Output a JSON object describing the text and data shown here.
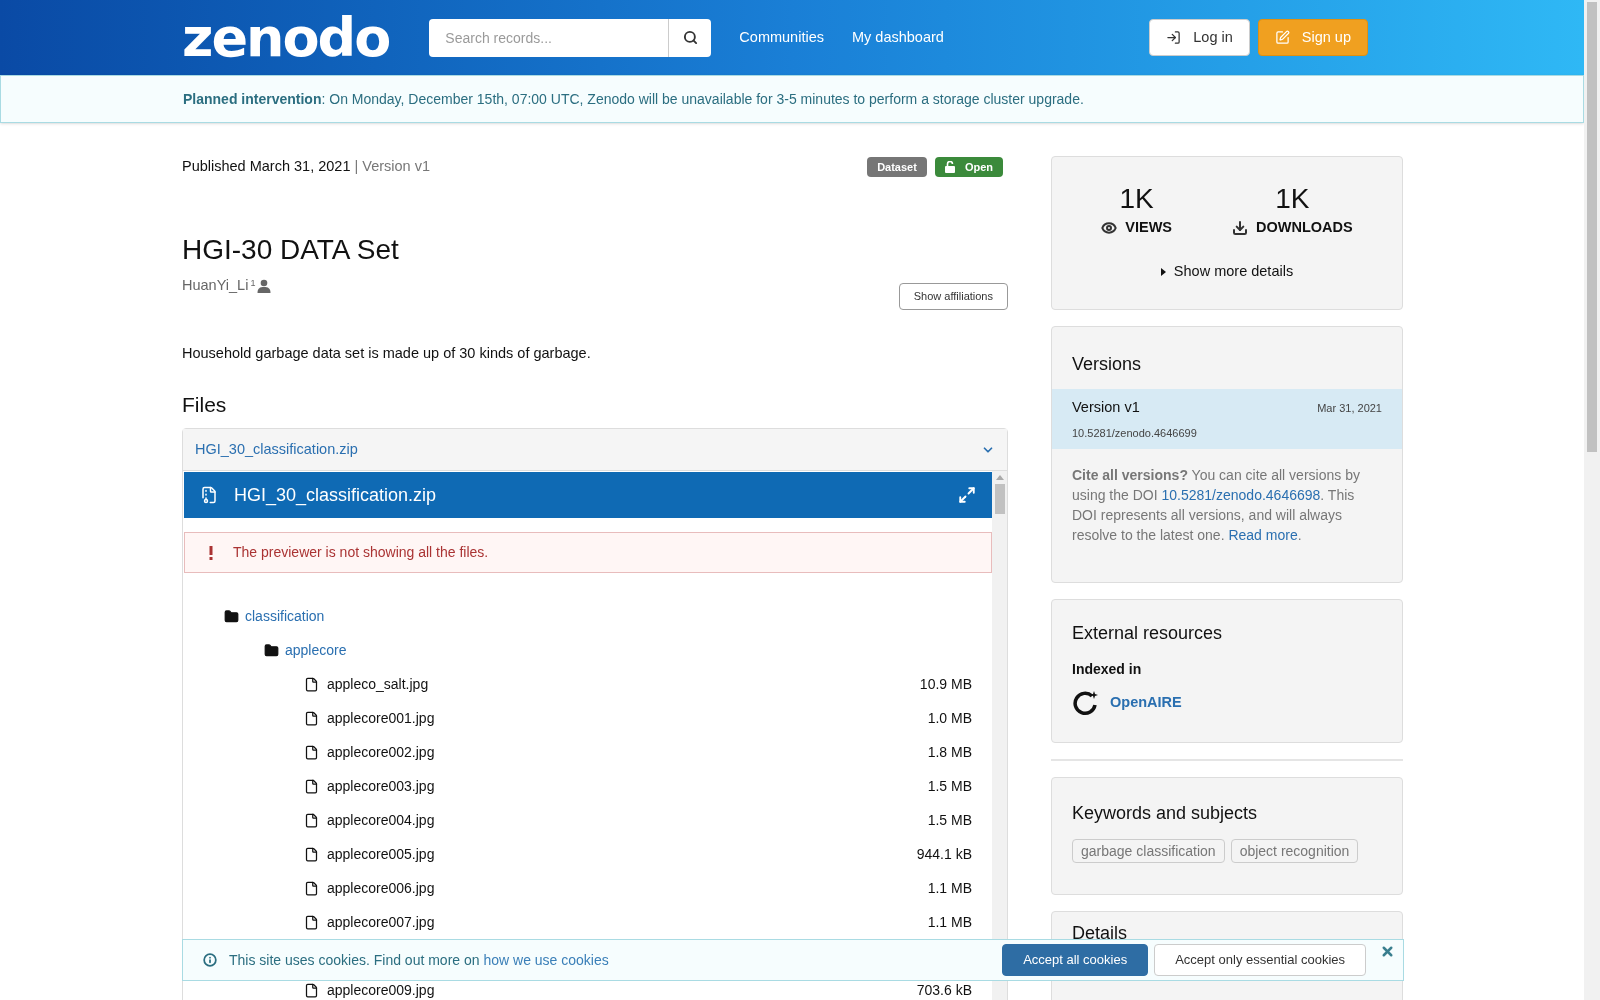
{
  "header": {
    "logo": "zenodo",
    "search": {
      "placeholder": "Search records..."
    },
    "nav": [
      "Communities",
      "My dashboard"
    ],
    "buttons": [
      {
        "label": "Log in",
        "kind": "login"
      },
      {
        "label": "Sign up",
        "kind": "signup"
      }
    ]
  },
  "banner": {
    "text": "**Planned intervention**: On Monday, December 15th, 07:00 UTC, Zenodo will be unavailable for 3-5 minutes to perform a storage cluster upgrade."
  },
  "record": {
    "published": "Published March 31, 2021",
    "version": "| Version v1",
    "badges": [
      {
        "label": "Dataset",
        "kind": "type"
      },
      {
        "label": "Open",
        "kind": "access"
      }
    ],
    "title": "HGI-30 DATA Set",
    "creators": [
      {
        "name": "HuanYi_Li",
        "mark": "1"
      }
    ],
    "show_affiliations": "Show affiliations",
    "description": "Household garbage data set is made up of 30 kinds of garbage.",
    "files_heading": "Files",
    "file_panel": {
      "link": "HGI_30_classification.zip",
      "expanded": true,
      "preview_title": "HGI_30_classification.zip",
      "warning": "The previewer is not showing all the files.",
      "tree": [
        {
          "kind": "folder",
          "name": "classification",
          "children": [
            {
              "kind": "folder",
              "name": "applecore",
              "children": [
                {
                  "kind": "file",
                  "name": "appleco_salt.jpg",
                  "size": "10.9 MB"
                },
                {
                  "kind": "file",
                  "name": "applecore001.jpg",
                  "size": "1.0 MB"
                },
                {
                  "kind": "file",
                  "name": "applecore002.jpg",
                  "size": "1.8 MB"
                },
                {
                  "kind": "file",
                  "name": "applecore003.jpg",
                  "size": "1.5 MB"
                },
                {
                  "kind": "file",
                  "name": "applecore004.jpg",
                  "size": "1.5 MB"
                },
                {
                  "kind": "file",
                  "name": "applecore005.jpg",
                  "size": "944.1 kB"
                },
                {
                  "kind": "file",
                  "name": "applecore006.jpg",
                  "size": "1.1 MB"
                },
                {
                  "kind": "file",
                  "name": "applecore007.jpg",
                  "size": "1.1 MB"
                },
                {
                  "kind": "hidden"
                },
                {
                  "kind": "file",
                  "name": "applecore009.jpg",
                  "size": "703.6 kB"
                }
              ]
            }
          ]
        }
      ]
    }
  },
  "sidebar": {
    "stats": [
      {
        "value": "1K",
        "label": "VIEWS",
        "kind": "views"
      },
      {
        "value": "1K",
        "label": "DOWNLOADS",
        "kind": "downloads"
      }
    ],
    "show_more": "Show more details",
    "versions": {
      "title": "Versions",
      "items": [
        {
          "label": "Version v1",
          "date": "Mar 31, 2021",
          "doi": "10.5281/zenodo.4646699",
          "selected": true
        }
      ],
      "cite": {
        "lead": "Cite all versions?",
        "text_1": " You can cite all versions by using the DOI ",
        "doi_link": "10.5281/zenodo.4646698",
        "text_2": ". This DOI represents all versions, and will always resolve to the latest one. ",
        "read_more": "Read more",
        "end": "."
      }
    },
    "external": {
      "title": "External resources",
      "indexed_in": "Indexed in",
      "items": [
        "OpenAIRE"
      ]
    },
    "keywords": {
      "title": "Keywords and subjects",
      "tags": [
        "garbage classification",
        "object recognition"
      ]
    },
    "details": {
      "title": "Details"
    }
  },
  "cookie_bar": {
    "text": "This site uses cookies. Find out more on ",
    "link": "how we use cookies",
    "buttons": [
      {
        "label": "Accept all cookies",
        "kind": "primary"
      },
      {
        "label": "Accept only essential cookies",
        "kind": "secondary"
      }
    ]
  }
}
